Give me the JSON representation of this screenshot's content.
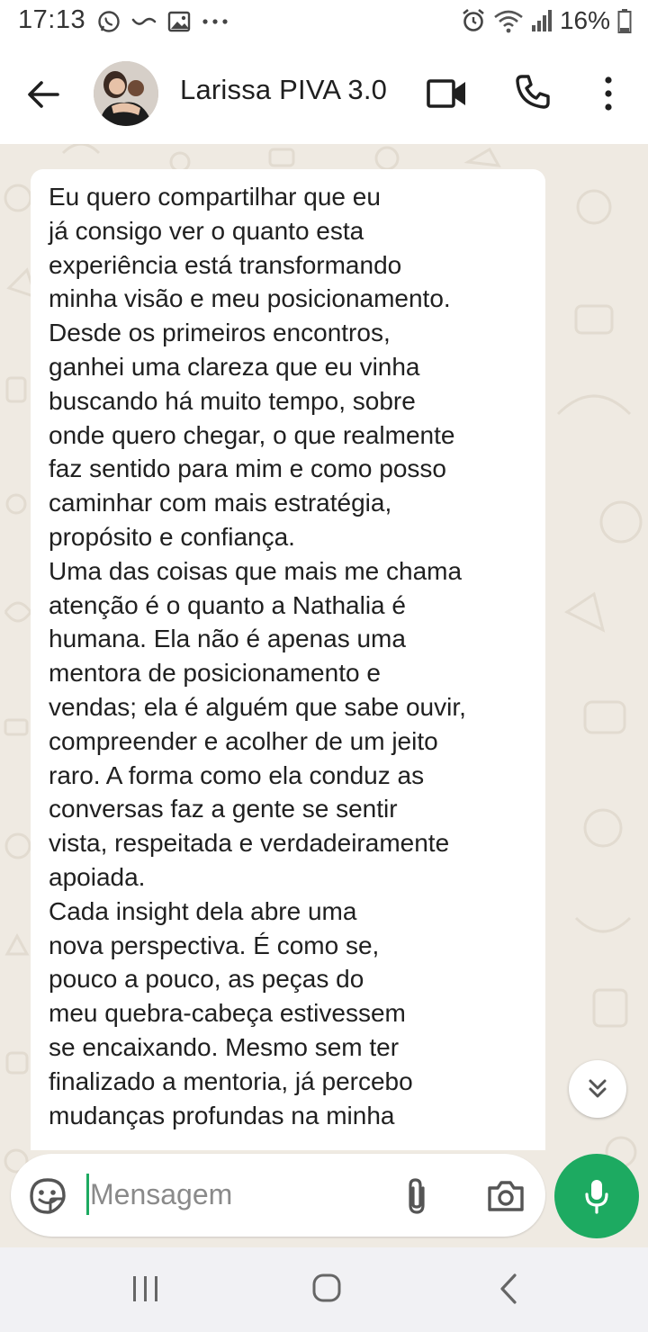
{
  "status_bar": {
    "time": "17:13",
    "battery": "16%",
    "left_icons": [
      "whatsapp-icon",
      "wave-icon",
      "gallery-icon",
      "more-notifications-icon"
    ],
    "right_icons": [
      "alarm-icon",
      "wifi-icon",
      "signal-icon",
      "battery-icon"
    ]
  },
  "header": {
    "contact_name": "Larissa PIVA 3.0",
    "icons": [
      "back-arrow-icon",
      "video-call-icon",
      "phone-icon",
      "more-vert-icon"
    ]
  },
  "message": {
    "text": "Eu quero compartilhar que eu\njá consigo ver o quanto esta\nexperiência está transformando\nminha visão e meu posicionamento.\nDesde os primeiros encontros,\nganhei uma clareza que eu vinha\nbuscando há muito tempo, sobre\nonde quero chegar, o que realmente\nfaz sentido para mim e como posso\ncaminhar com mais estratégia,\npropósito e confiança.\nUma das coisas que mais me chama\natenção é o quanto a Nathalia é\nhumana. Ela não é apenas uma\nmentora de posicionamento e\nvendas; ela é alguém que sabe ouvir,\ncompreender e acolher de um jeito\nraro. A forma como ela conduz as\nconversas faz a gente se sentir\nvista, respeitada e verdadeiramente\napoiada.\nCada insight dela abre uma\nnova perspectiva. É como se,\npouco a pouco, as peças do\nmeu quebra-cabeça estivessem\nse encaixando. Mesmo sem ter\nfinalizado a mentoria, já percebo\nmudanças profundas na minha"
  },
  "composer": {
    "placeholder": "Mensagem",
    "icons": [
      "sticker-icon",
      "attach-icon",
      "camera-icon",
      "mic-icon"
    ]
  },
  "colors": {
    "accent": "#1daa61",
    "chat_background": "#efeae2",
    "bubble": "#ffffff"
  }
}
